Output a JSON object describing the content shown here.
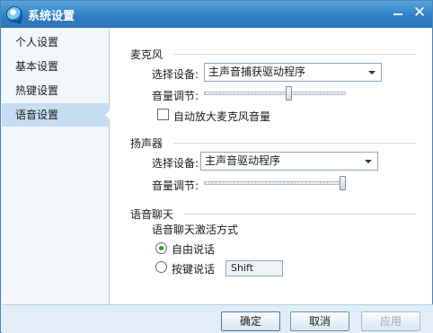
{
  "window": {
    "title": "系统设置"
  },
  "sidebar": {
    "items": [
      {
        "label": "个人设置",
        "selected": false
      },
      {
        "label": "基本设置",
        "selected": false
      },
      {
        "label": "热键设置",
        "selected": false
      },
      {
        "label": "语音设置",
        "selected": true
      }
    ]
  },
  "microphone": {
    "title": "麦克风",
    "device_label": "选择设备:",
    "device_value": "主声音捕获驱动程序",
    "volume_label": "音量调节:",
    "volume_level": 0.6,
    "auto_boost_label": "自动放大麦克风音量",
    "auto_boost_checked": false
  },
  "speaker": {
    "title": "扬声器",
    "device_label": "选择设备:",
    "device_value": "主声音驱动程序",
    "volume_label": "音量调节:",
    "volume_level": 1.0
  },
  "voice_chat": {
    "title": "语音聊天",
    "mode_label": "语音聊天激活方式",
    "options": [
      {
        "label": "自由说话",
        "checked": true
      },
      {
        "label": "按键说话",
        "checked": false
      }
    ],
    "hotkey_value": "Shift"
  },
  "footer": {
    "ok_label": "确定",
    "cancel_label": "取消",
    "apply_label": "应用"
  },
  "colors": {
    "titlebar": "#2f7fc4",
    "selected_nav": "#c6dcf0",
    "radio_dot": "#2a9a2a"
  }
}
